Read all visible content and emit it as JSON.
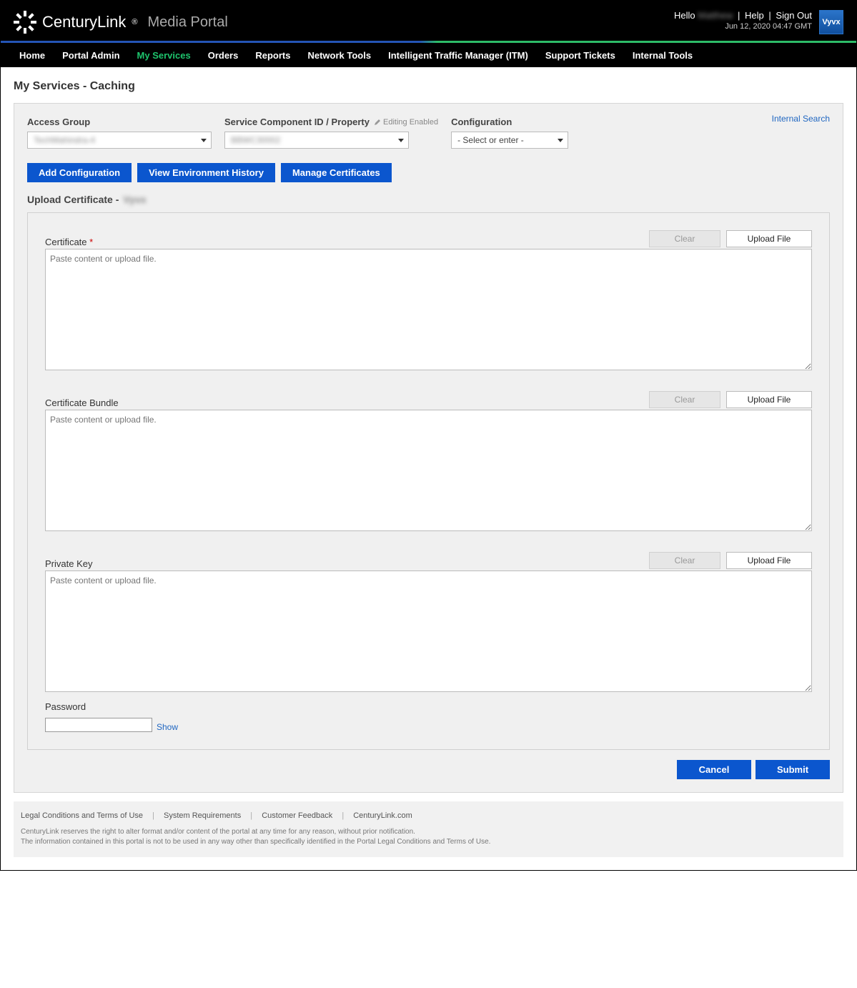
{
  "header": {
    "brand_name": "CenturyLink",
    "brand_suffix": "Media Portal",
    "hello": "Hello",
    "username": "Matthew",
    "help": "Help",
    "sign_out": "Sign Out",
    "timestamp": "Jun 12, 2020 04:47 GMT",
    "tile_text": "Vyvx"
  },
  "nav": {
    "items": [
      "Home",
      "Portal Admin",
      "My Services",
      "Orders",
      "Reports",
      "Network Tools",
      "Intelligent Traffic Manager (ITM)",
      "Support Tickets",
      "Internal Tools"
    ],
    "active_index": 2
  },
  "page": {
    "title": "My Services - Caching",
    "internal_search": "Internal Search"
  },
  "selectors": {
    "access_group_label": "Access Group",
    "access_group_value": "TechMahindra-4",
    "scid_label": "Service Component ID / Property",
    "editing_enabled": "Editing Enabled",
    "scid_value": "BBWC30002",
    "config_label": "Configuration",
    "config_value": "- Select or enter -"
  },
  "buttons": {
    "add_config": "Add Configuration",
    "view_env": "View Environment History",
    "manage_certs": "Manage Certificates",
    "clear": "Clear",
    "upload_file": "Upload File",
    "cancel": "Cancel",
    "submit": "Submit",
    "show": "Show"
  },
  "upload": {
    "section_title_prefix": "Upload Certificate -",
    "section_title_value": "Vyvx",
    "certificate_label": "Certificate",
    "bundle_label": "Certificate Bundle",
    "private_key_label": "Private Key",
    "placeholder": "Paste content or upload file.",
    "password_label": "Password"
  },
  "footer": {
    "links": [
      "Legal Conditions and Terms of Use",
      "System Requirements",
      "Customer Feedback",
      "CenturyLink.com"
    ],
    "disclaimer1": "CenturyLink reserves the right to alter format and/or content of the portal at any time for any reason, without prior notification.",
    "disclaimer2": "The information contained in this portal is not to be used in any way other than specifically identified in the Portal Legal Conditions and Terms of Use."
  }
}
